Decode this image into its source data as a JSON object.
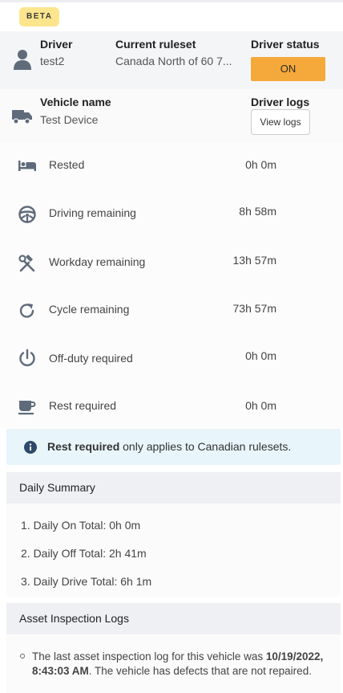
{
  "badge": "BETA",
  "driver": {
    "label": "Driver",
    "name": "test2",
    "ruleset_label": "Current ruleset",
    "ruleset_value": "Canada North of 60 7...",
    "status_label": "Driver status",
    "status_value": "ON",
    "status_color": "#f5a93a"
  },
  "vehicle": {
    "label": "Vehicle name",
    "name": "Test Device",
    "logs_label": "Driver logs",
    "view_logs": "View logs"
  },
  "metrics": [
    {
      "icon": "bed-icon",
      "label": "Rested",
      "value": "0h 0m"
    },
    {
      "icon": "steering-wheel-icon",
      "label": "Driving remaining",
      "value": "8h 58m"
    },
    {
      "icon": "tools-icon",
      "label": "Workday remaining",
      "value": "13h 57m"
    },
    {
      "icon": "cycle-icon",
      "label": "Cycle remaining",
      "value": "73h 57m"
    },
    {
      "icon": "power-icon",
      "label": "Off-duty required",
      "value": "0h 0m"
    },
    {
      "icon": "coffee-icon",
      "label": "Rest required",
      "value": "0h 0m"
    }
  ],
  "notice": {
    "bold": "Rest required",
    "rest": " only applies to Canadian rulesets."
  },
  "daily_summary": {
    "title": "Daily Summary",
    "items": [
      "1. Daily On Total: 0h 0m",
      "2. Daily Off Total: 2h 41m",
      "3. Daily Drive Total: 6h 1m"
    ]
  },
  "inspection": {
    "title": "Asset Inspection Logs",
    "text_before": "The last asset inspection log for this vehicle was ",
    "date": "10/19/2022, 8:43:03 AM",
    "text_after": ". The vehicle has defects that are not repaired."
  }
}
